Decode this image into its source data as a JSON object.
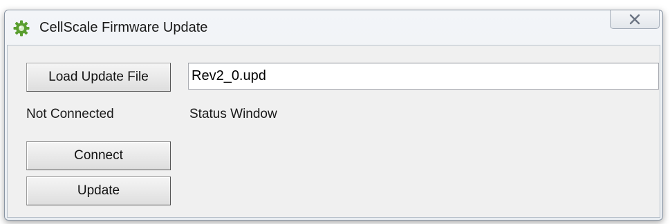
{
  "window": {
    "title": "CellScale Firmware Update",
    "icon": "gear-icon",
    "close_icon": "close-icon"
  },
  "controls": {
    "load_button_label": "Load Update File",
    "file_field_value": "Rev2_0.upd",
    "connection_status": "Not Connected",
    "status_window_label": "Status Window",
    "connect_button_label": "Connect",
    "update_button_label": "Update"
  },
  "colors": {
    "icon_green": "#4e9a2a",
    "window_border": "#8a95a3",
    "client_background": "#f0f0f0"
  }
}
